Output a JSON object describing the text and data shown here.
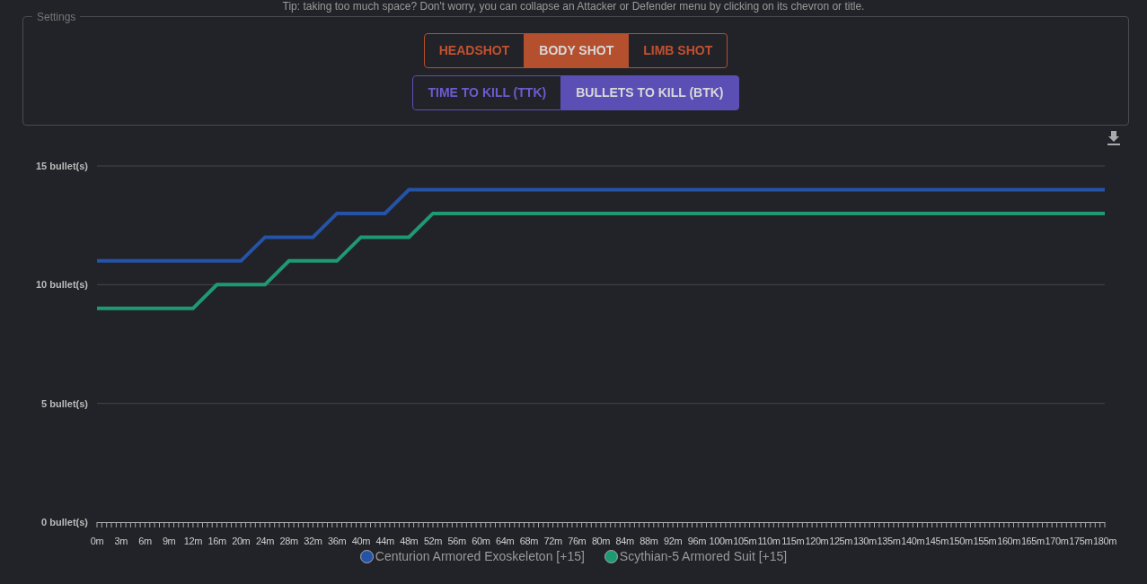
{
  "tip": "Tip: taking too much space? Don't worry, you can collapse an Attacker or Defender menu by clicking on its chevron or title.",
  "settings": {
    "title": "Settings",
    "hit_zones": [
      {
        "label": "HEADSHOT",
        "selected": false
      },
      {
        "label": "BODY SHOT",
        "selected": true
      },
      {
        "label": "LIMB SHOT",
        "selected": false
      }
    ],
    "metrics": [
      {
        "label": "TIME TO KILL (TTK)",
        "selected": false
      },
      {
        "label": "BULLETS TO KILL (BTK)",
        "selected": true
      }
    ]
  },
  "chart": {
    "chart_data": {
      "type": "line",
      "categories": [
        "0m",
        "3m",
        "6m",
        "9m",
        "12m",
        "16m",
        "20m",
        "24m",
        "28m",
        "32m",
        "36m",
        "40m",
        "44m",
        "48m",
        "52m",
        "56m",
        "60m",
        "64m",
        "68m",
        "72m",
        "76m",
        "80m",
        "84m",
        "88m",
        "92m",
        "96m",
        "100m",
        "105m",
        "110m",
        "115m",
        "120m",
        "125m",
        "130m",
        "135m",
        "140m",
        "145m",
        "150m",
        "155m",
        "160m",
        "165m",
        "170m",
        "175m",
        "180m"
      ],
      "ylim": [
        0,
        15
      ],
      "yticks": [
        {
          "value": 0,
          "label": "0 bullet(s)"
        },
        {
          "value": 5,
          "label": "5 bullet(s)"
        },
        {
          "value": 10,
          "label": "10 bullet(s)"
        },
        {
          "value": 15,
          "label": "15 bullet(s)"
        }
      ],
      "series": [
        {
          "name": "Centurion Armored Exoskeleton [+15]",
          "color": "#2453a8",
          "values": [
            11,
            11,
            11,
            11,
            11,
            11,
            11,
            12,
            12,
            12,
            13,
            13,
            13,
            14,
            14,
            14,
            14,
            14,
            14,
            14,
            14,
            14,
            14,
            14,
            14,
            14,
            14,
            14,
            14,
            14,
            14,
            14,
            14,
            14,
            14,
            14,
            14,
            14,
            14,
            14,
            14,
            14,
            14
          ]
        },
        {
          "name": "Scythian-5 Armored Suit [+15]",
          "color": "#1e9a73",
          "values": [
            9,
            9,
            9,
            9,
            9,
            10,
            10,
            10,
            11,
            11,
            11,
            12,
            12,
            12,
            13,
            13,
            13,
            13,
            13,
            13,
            13,
            13,
            13,
            13,
            13,
            13,
            13,
            13,
            13,
            13,
            13,
            13,
            13,
            13,
            13,
            13,
            13,
            13,
            13,
            13,
            13,
            13,
            13
          ]
        }
      ]
    }
  }
}
